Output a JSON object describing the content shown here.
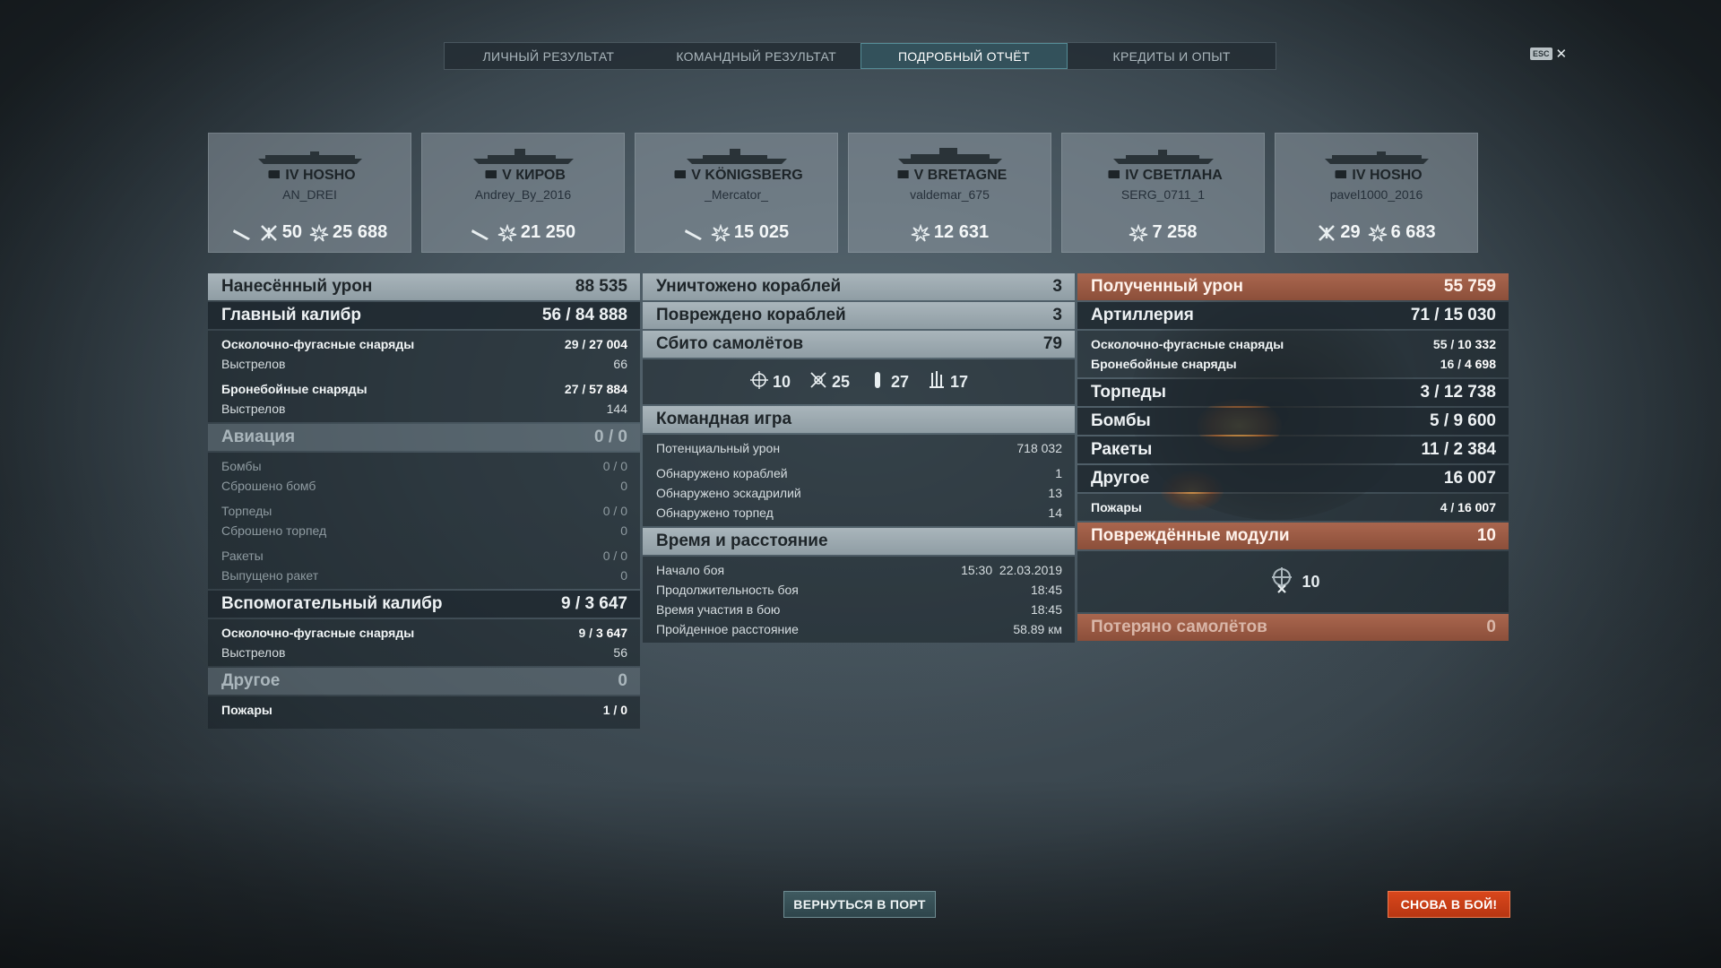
{
  "tabs": [
    "ЛИЧНЫЙ РЕЗУЛЬТАТ",
    "КОМАНДНЫЙ РЕЗУЛЬТАТ",
    "ПОДРОБНЫЙ ОТЧЁТ",
    "КРЕДИТЫ И ОПЫТ"
  ],
  "active_tab": "ПОДРОБНЫЙ ОТЧЁТ",
  "esc": {
    "key": "ESC",
    "close": "✕"
  },
  "cards": [
    {
      "ship": "IV HOSHO",
      "player": "AN_DREI",
      "ribbon_icon": "torpedo-icon",
      "planes": "50",
      "damage": "25 688"
    },
    {
      "ship": "V КИРОВ",
      "player": "Andrey_By_2016",
      "ribbon_icon": "torpedo-icon",
      "damage": "21 250"
    },
    {
      "ship": "V KÖNIGSBERG",
      "player": "_Mercator_",
      "ribbon_icon": "torpedo-icon",
      "damage": "15 025"
    },
    {
      "ship": "V BRETAGNE",
      "player": "valdemar_675",
      "damage": "12 631"
    },
    {
      "ship": "IV СВЕТЛАНА",
      "player": "SERG_0711_1",
      "damage": "7 258"
    },
    {
      "ship": "IV HOSHO",
      "player": "pavel1000_2016",
      "planes": "29",
      "damage": "6 683"
    }
  ],
  "dealt": {
    "title": "Нанесённый урон",
    "total": "88 535",
    "main": {
      "label": "Главный калибр",
      "hits": "56",
      "value": "84 888"
    },
    "he": {
      "label": "Осколочно-фугасные снаряды",
      "hits": "29",
      "value": "27 004",
      "shots_label": "Выстрелов",
      "shots": "66"
    },
    "ap": {
      "label": "Бронебойные снаряды",
      "hits": "27",
      "value": "57 884",
      "shots_label": "Выстрелов",
      "shots": "144"
    },
    "aviation": {
      "label": "Авиация",
      "hits": "0",
      "value": "0",
      "bombs": {
        "label": "Бомбы",
        "hits": "0",
        "value": "0",
        "sub": "Сброшено бомб",
        "sub_val": "0"
      },
      "torps": {
        "label": "Торпеды",
        "hits": "0",
        "value": "0",
        "sub": "Сброшено торпед",
        "sub_val": "0"
      },
      "rockets": {
        "label": "Ракеты",
        "hits": "0",
        "value": "0",
        "sub": "Выпущено ракет",
        "sub_val": "0"
      }
    },
    "secondary": {
      "label": "Вспомогательный калибр",
      "hits": "9",
      "value": "3 647",
      "he": {
        "label": "Осколочно-фугасные снаряды",
        "hits": "9",
        "value": "3 647",
        "shots_label": "Выстрелов",
        "shots": "56"
      }
    },
    "other": {
      "label": "Другое",
      "value": "0",
      "fires": {
        "label": "Пожары",
        "hits": "1",
        "value": "0"
      }
    }
  },
  "mid": {
    "destroyed": {
      "label": "Уничтожено кораблей",
      "value": "3"
    },
    "damaged": {
      "label": "Повреждено кораблей",
      "value": "3"
    },
    "planes": {
      "label": "Сбито самолётов",
      "value": "79",
      "breakdown": [
        {
          "icon": "crosshair-icon",
          "value": "10"
        },
        {
          "icon": "fighter-icon",
          "value": "25"
        },
        {
          "icon": "bomb-icon",
          "value": "27"
        },
        {
          "icon": "torpedo-bomber-icon",
          "value": "17"
        }
      ]
    },
    "team": {
      "label": "Командная игра",
      "potential": {
        "label": "Потенциальный урон",
        "value": "718 032"
      },
      "spotted_ships": {
        "label": "Обнаружено кораблей",
        "value": "1"
      },
      "spotted_sq": {
        "label": "Обнаружено эскадрилий",
        "value": "13"
      },
      "spotted_torps": {
        "label": "Обнаружено торпед",
        "value": "14"
      }
    },
    "time": {
      "label": "Время и расстояние",
      "start": {
        "label": "Начало боя",
        "time": "15:30",
        "date": "22.03.2019"
      },
      "duration": {
        "label": "Продолжительность боя",
        "value": "18:45"
      },
      "participation": {
        "label": "Время участия в бою",
        "value": "18:45"
      },
      "distance": {
        "label": "Пройденное расстояние",
        "value": "58.89 км"
      }
    }
  },
  "received": {
    "title": "Полученный урон",
    "total": "55 759",
    "artillery": {
      "label": "Артиллерия",
      "hits": "71",
      "value": "15 030",
      "he": {
        "label": "Осколочно-фугасные снаряды",
        "hits": "55",
        "value": "10 332"
      },
      "ap": {
        "label": "Бронебойные снаряды",
        "hits": "16",
        "value": "4 698"
      }
    },
    "torps": {
      "label": "Торпеды",
      "hits": "3",
      "value": "12 738"
    },
    "bombs": {
      "label": "Бомбы",
      "hits": "5",
      "value": "9 600"
    },
    "rockets": {
      "label": "Ракеты",
      "hits": "11",
      "value": "2 384"
    },
    "other": {
      "label": "Другое",
      "value": "16 007",
      "fires": {
        "label": "Пожары",
        "hits": "4",
        "value": "16 007"
      }
    },
    "modules": {
      "label": "Повреждённые модули",
      "value": "10",
      "icon_value": "10"
    },
    "lost": {
      "label": "Потеряно самолётов",
      "value": "0"
    }
  },
  "buttons": {
    "port": "ВЕРНУТЬСЯ В ПОРТ",
    "again": "СНОВА В БОЙ!"
  },
  "colors": {
    "accent_orange": "#c8401a",
    "received_header": "#9a5a43",
    "tab_active": "#375a64"
  }
}
